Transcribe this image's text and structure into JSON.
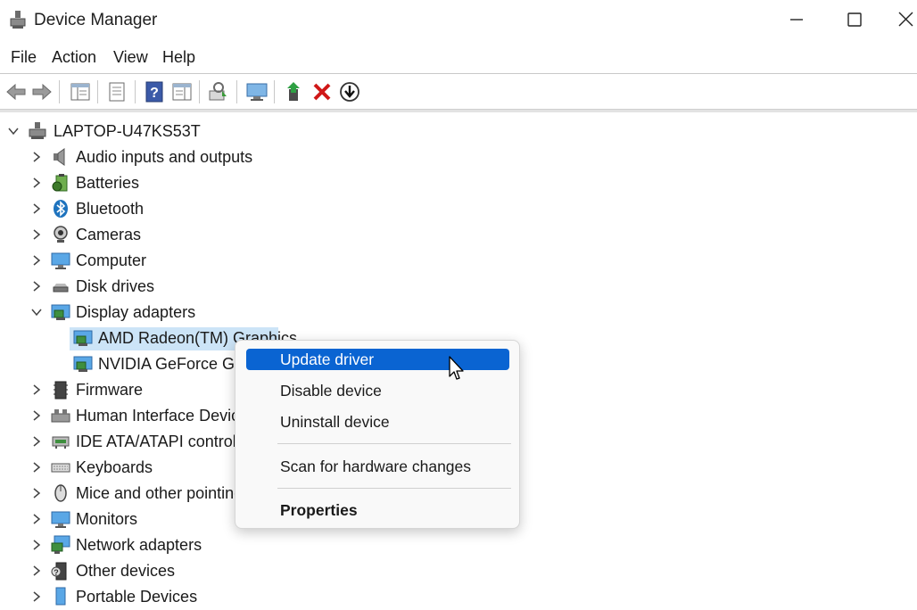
{
  "window": {
    "title": "Device Manager",
    "controls": [
      "minimize-icon",
      "maximize-icon",
      "close-icon"
    ]
  },
  "menubar": {
    "items": [
      {
        "label": "File"
      },
      {
        "label": "Action"
      },
      {
        "label": "View"
      },
      {
        "label": "Help"
      }
    ]
  },
  "toolbar": {
    "buttons": [
      "back-icon",
      "forward-icon",
      "show-hide-console-tree-icon",
      "properties-icon",
      "help-icon",
      "action-pane-icon",
      "scan-hardware-icon",
      "monitor-icon",
      "update-driver-icon",
      "uninstall-icon",
      "download-icon"
    ]
  },
  "tree": {
    "root": "LAPTOP-U47KS53T",
    "categories": [
      {
        "label": "Audio inputs and outputs",
        "icon": "speaker-icon"
      },
      {
        "label": "Batteries",
        "icon": "battery-icon"
      },
      {
        "label": "Bluetooth",
        "icon": "bluetooth-icon"
      },
      {
        "label": "Cameras",
        "icon": "camera-icon"
      },
      {
        "label": "Computer",
        "icon": "computer-icon"
      },
      {
        "label": "Disk drives",
        "icon": "disk-drive-icon"
      },
      {
        "label": "Display adapters",
        "icon": "display-adapter-icon",
        "expanded": true,
        "children": [
          {
            "label": "AMD Radeon(TM) Graphics",
            "selected": true
          },
          {
            "label": "NVIDIA GeForce GTX"
          }
        ]
      },
      {
        "label": "Firmware",
        "icon": "firmware-icon"
      },
      {
        "label": "Human Interface Devices",
        "icon": "hid-icon"
      },
      {
        "label": "IDE ATA/ATAPI controllers",
        "icon": "ide-controller-icon"
      },
      {
        "label": "Keyboards",
        "icon": "keyboard-icon"
      },
      {
        "label": "Mice and other pointing",
        "icon": "mouse-icon"
      },
      {
        "label": "Monitors",
        "icon": "monitor-icon"
      },
      {
        "label": "Network adapters",
        "icon": "network-adapter-icon"
      },
      {
        "label": "Other devices",
        "icon": "other-devices-icon"
      },
      {
        "label": "Portable Devices",
        "icon": "portable-devices-icon"
      }
    ]
  },
  "context_menu": {
    "items": [
      {
        "label": "Update driver",
        "highlighted": true
      },
      {
        "label": "Disable device"
      },
      {
        "label": "Uninstall device"
      },
      {
        "label": "Scan for hardware changes"
      },
      {
        "label": "Properties",
        "bold": true
      }
    ]
  },
  "colors": {
    "selection": "#cce4f7",
    "menu_highlight": "#0a64d2",
    "accent_blue": "#1e73be"
  }
}
